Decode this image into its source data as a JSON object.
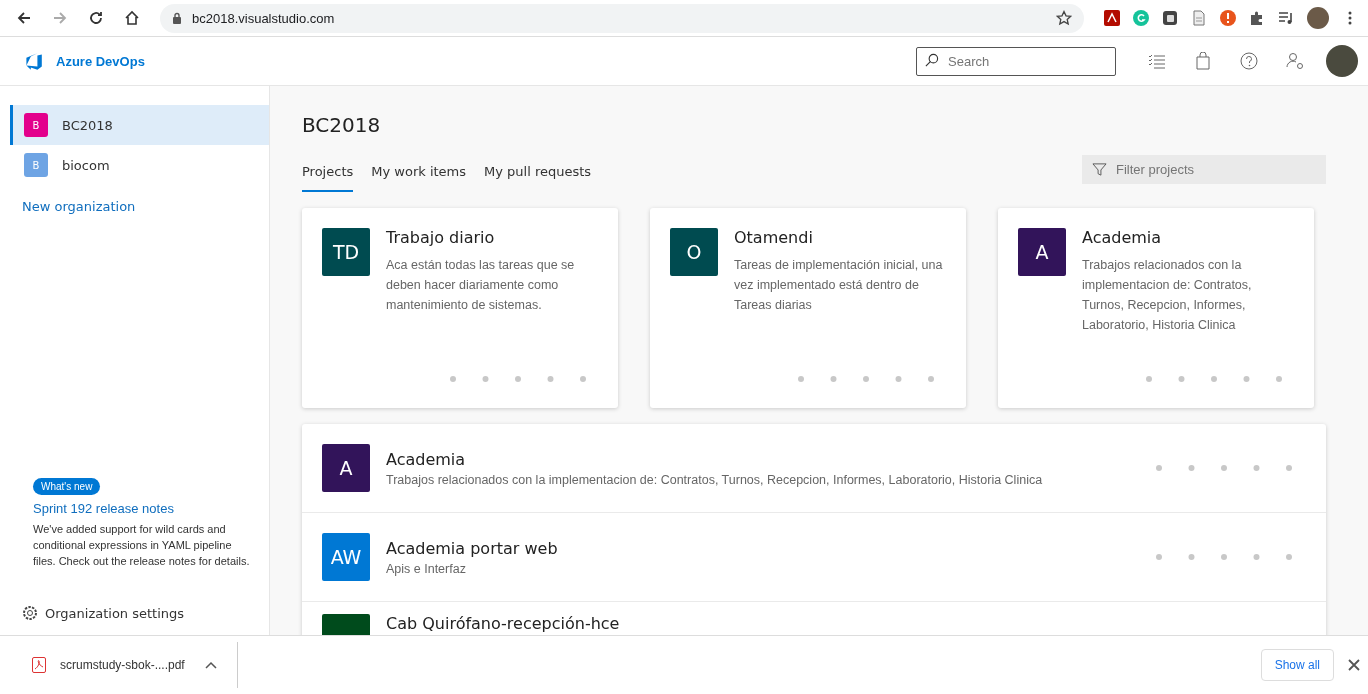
{
  "browser": {
    "url": "bc2018.visualstudio.com"
  },
  "header": {
    "brand": "Azure DevOps",
    "search": {
      "placeholder": "Search"
    }
  },
  "sidebar": {
    "organizations": [
      {
        "initial": "B",
        "name": "BC2018",
        "color": "#e3008c",
        "selected": true
      },
      {
        "initial": "B",
        "name": "biocom",
        "color": "#6ea4e4",
        "selected": false
      }
    ],
    "new_organization": "New organization",
    "whats_new": {
      "badge": "What's new",
      "link": "Sprint 192 release notes",
      "text": "We've added support for wild cards and conditional expressions in YAML pipeline files. Check out the release notes for details."
    },
    "settings": "Organization settings"
  },
  "main": {
    "title": "BC2018",
    "tabs": [
      {
        "label": "Projects",
        "selected": true
      },
      {
        "label": "My work items",
        "selected": false
      },
      {
        "label": "My pull requests",
        "selected": false
      }
    ],
    "filter": {
      "placeholder": "Filter projects"
    },
    "cards": [
      {
        "initials": "TD",
        "name": "Trabajo diario",
        "description": "Aca están todas las tareas que se deben hacer diariamente como mantenimiento de sistemas.",
        "color": "#004b50"
      },
      {
        "initials": "O",
        "name": "Otamendi",
        "description": "Tareas de implementación inicial, una vez implementado está dentro de Tareas diarias",
        "color": "#004b50"
      },
      {
        "initials": "A",
        "name": "Academia",
        "description": "Trabajos relacionados con la implementacion de: Contratos, Turnos, Recepcion, Informes, Laboratorio, Historia Clinica",
        "color": "#32145a"
      }
    ],
    "projects": [
      {
        "initials": "A",
        "name": "Academia",
        "description": "Trabajos relacionados con la implementacion de: Contratos, Turnos, Recepcion, Informes, Laboratorio, Historia Clinica",
        "color": "#32145a"
      },
      {
        "initials": "AW",
        "name": "Academia portar web",
        "description": "Apis e Interfaz",
        "color": "#0078d4"
      },
      {
        "name": "Cab Quirófano-recepción-hce",
        "color": "#004b1c"
      }
    ]
  },
  "download_bar": {
    "file": "scrumstudy-sbok-....pdf",
    "show_all": "Show all"
  }
}
